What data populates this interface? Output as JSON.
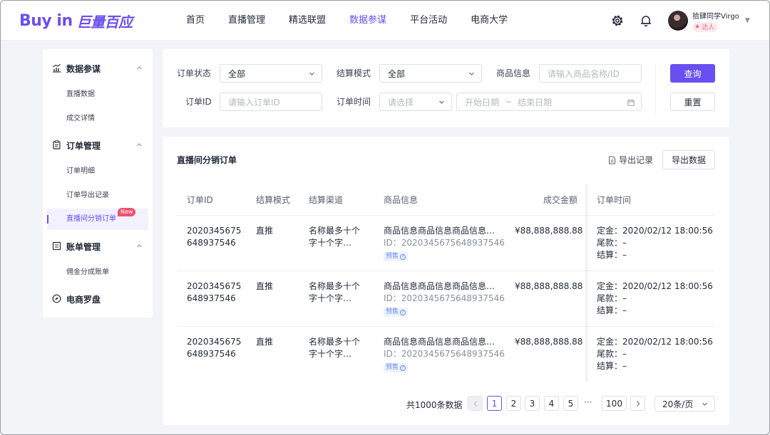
{
  "brand": {
    "logo_en": "Buy in",
    "logo_cn": "巨量百应",
    "accent": "#6a4ff0"
  },
  "nav": {
    "items": [
      {
        "label": "首页"
      },
      {
        "label": "直播管理"
      },
      {
        "label": "精选联盟"
      },
      {
        "label": "数据参谋",
        "active": true
      },
      {
        "label": "平台活动"
      },
      {
        "label": "电商大学"
      }
    ]
  },
  "user": {
    "name": "拾肆同学Virgo",
    "tag": "达人"
  },
  "sidebar": {
    "groups": [
      {
        "label": "数据参谋",
        "icon": "chart-icon",
        "items": [
          {
            "label": "直播数据"
          },
          {
            "label": "成交详情"
          }
        ]
      },
      {
        "label": "订单管理",
        "icon": "clipboard-icon",
        "items": [
          {
            "label": "订单明细"
          },
          {
            "label": "订单导出记录"
          },
          {
            "label": "直播间分销订单",
            "active": true,
            "badge": "New"
          }
        ]
      },
      {
        "label": "账单管理",
        "icon": "bill-icon",
        "items": [
          {
            "label": "佣金分成账单"
          }
        ]
      },
      {
        "label": "电商罗盘",
        "icon": "compass-icon",
        "items": []
      }
    ]
  },
  "filters": {
    "order_status": {
      "label": "订单状态",
      "value": "全部"
    },
    "settle_mode": {
      "label": "结算模式",
      "value": "全部"
    },
    "product_info": {
      "label": "商品信息",
      "placeholder": "请输入商品名称/ID"
    },
    "order_id": {
      "label": "订单ID",
      "placeholder": "请输入订单ID"
    },
    "order_time": {
      "label": "订单时间",
      "select_placeholder": "请选择",
      "start_placeholder": "开始日期",
      "separator": "~",
      "end_placeholder": "结束日期"
    },
    "query_label": "查询",
    "reset_label": "重置"
  },
  "table": {
    "title": "直播间分销订单",
    "export_record_label": "导出记录",
    "export_data_label": "导出数据",
    "columns": [
      "订单ID",
      "结算模式",
      "结算渠道",
      "商品信息",
      "成交金额",
      "订单时间"
    ],
    "rows": [
      {
        "order_id_1": "2020345675",
        "order_id_2": "648937546",
        "mode": "直推",
        "channel_1": "名称最多十个",
        "channel_2": "字十个字…",
        "product_name": "商品信息商品信息商品信息…",
        "product_id": "ID：2020345675648937546",
        "presale": "预售",
        "amount": "¥88,888,888.88",
        "deposit": "定金：2020/02/12 18:00:56",
        "balance": "尾款：–",
        "settle": "结算：–"
      },
      {
        "order_id_1": "2020345675",
        "order_id_2": "648937546",
        "mode": "直推",
        "channel_1": "名称最多十个",
        "channel_2": "字十个字…",
        "product_name": "商品信息商品信息商品信息…",
        "product_id": "ID：2020345675648937546",
        "presale": "预售",
        "amount": "¥88,888,888.88",
        "deposit": "定金：2020/02/12 18:00:56",
        "balance": "尾款：–",
        "settle": "结算：–"
      },
      {
        "order_id_1": "2020345675",
        "order_id_2": "648937546",
        "mode": "直推",
        "channel_1": "名称最多十个",
        "channel_2": "字十个字…",
        "product_name": "商品信息商品信息商品信息…",
        "product_id": "ID：2020345675648937546",
        "presale": "预售",
        "amount": "¥88,888,888.88",
        "deposit": "定金：2020/02/12 18:00:56",
        "balance": "尾款：–",
        "settle": "结算：–"
      }
    ]
  },
  "pagination": {
    "total_text": "共1000条数据",
    "pages": [
      "1",
      "2",
      "3",
      "4",
      "5"
    ],
    "current": "1",
    "ellipsis": "···",
    "last": "100",
    "page_size": "20条/页"
  }
}
